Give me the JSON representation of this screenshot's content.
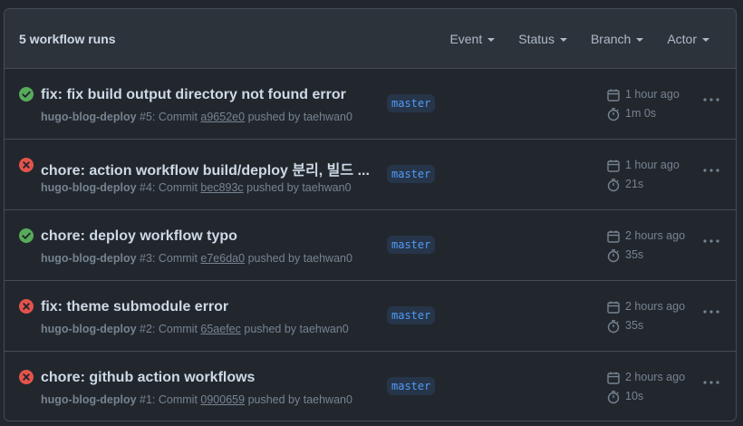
{
  "header": {
    "count_label": "5 workflow runs",
    "filters": [
      {
        "label": "Event"
      },
      {
        "label": "Status"
      },
      {
        "label": "Branch"
      },
      {
        "label": "Actor"
      }
    ]
  },
  "colors": {
    "success": "#57ab5a",
    "failure": "#e5534b",
    "branch_text": "#539bf5"
  },
  "runs": [
    {
      "status": "success",
      "status_icon": "check-circle-icon",
      "title": "fix: fix build output directory not found error",
      "workflow": "hugo-blog-deploy",
      "run_number": "#5",
      "commit_prefix": ": Commit",
      "commit": "a9652e0",
      "pushed_by": "pushed by taehwan0",
      "branch": "master",
      "time_ago": "1 hour ago",
      "duration": "1m 0s"
    },
    {
      "status": "failure",
      "status_icon": "x-circle-icon",
      "title": "chore: action workflow build/deploy 분리, 빌드 ...",
      "workflow": "hugo-blog-deploy",
      "run_number": "#4",
      "commit_prefix": ": Commit",
      "commit": "bec893c",
      "pushed_by": "pushed by taehwan0",
      "branch": "master",
      "time_ago": "1 hour ago",
      "duration": "21s"
    },
    {
      "status": "success",
      "status_icon": "check-circle-icon",
      "title": "chore: deploy workflow typo",
      "workflow": "hugo-blog-deploy",
      "run_number": "#3",
      "commit_prefix": ": Commit",
      "commit": "e7e6da0",
      "pushed_by": "pushed by taehwan0",
      "branch": "master",
      "time_ago": "2 hours ago",
      "duration": "35s"
    },
    {
      "status": "failure",
      "status_icon": "x-circle-icon",
      "title": "fix: theme submodule error",
      "workflow": "hugo-blog-deploy",
      "run_number": "#2",
      "commit_prefix": ": Commit",
      "commit": "65aefec",
      "pushed_by": "pushed by taehwan0",
      "branch": "master",
      "time_ago": "2 hours ago",
      "duration": "35s"
    },
    {
      "status": "failure",
      "status_icon": "x-circle-icon",
      "title": "chore: github action workflows",
      "workflow": "hugo-blog-deploy",
      "run_number": "#1",
      "commit_prefix": ": Commit",
      "commit": "0900659",
      "pushed_by": "pushed by taehwan0",
      "branch": "master",
      "time_ago": "2 hours ago",
      "duration": "10s"
    }
  ]
}
